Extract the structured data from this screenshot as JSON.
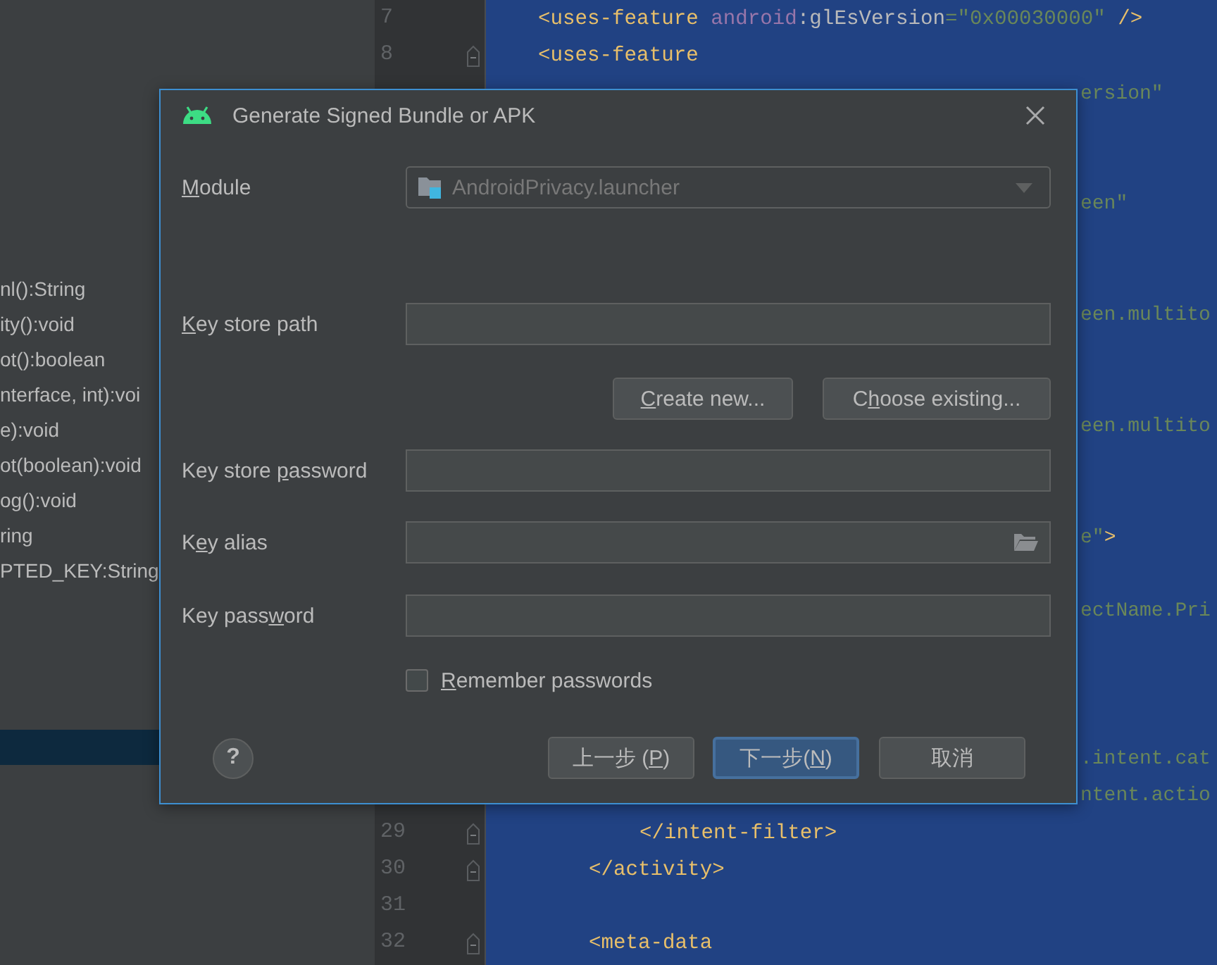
{
  "structure": {
    "items": [
      {
        "label": "nl():String",
        "selected": false
      },
      {
        "label": "ity():void",
        "selected": false
      },
      {
        "label": "ot():boolean",
        "selected": false
      },
      {
        "label": "nterface, int):voi",
        "selected": false
      },
      {
        "label": "e):void",
        "selected": false
      },
      {
        "label": "ot(boolean):void",
        "selected": false
      },
      {
        "label": "og():void",
        "selected": false
      },
      {
        "label": "ring",
        "selected": false
      },
      {
        "label": "PTED_KEY:String",
        "selected": false
      },
      {
        "selected": true
      }
    ]
  },
  "editor": {
    "lines": [
      {
        "kind": "code",
        "number": "7",
        "tokens": [
          {
            "text": "<uses-feature",
            "kind": "tag"
          },
          {
            "text": " android",
            "kind": "ns"
          },
          {
            "text": ":glEsVersion",
            "kind": "attr"
          },
          {
            "text": "=\"0x00030000\"",
            "kind": "value"
          },
          {
            "text": " />",
            "kind": "tag"
          }
        ]
      },
      {
        "kind": "code",
        "number": "8",
        "fold": true,
        "tokens": [
          {
            "text": "<uses-feature",
            "kind": "tag"
          }
        ]
      },
      {
        "kind": "fragment",
        "tokens": [
          {
            "text": "ersion\"",
            "kind": "value"
          }
        ]
      },
      {
        "kind": "covered"
      },
      {
        "kind": "covered"
      },
      {
        "kind": "fragment",
        "tokens": [
          {
            "text": "een\"",
            "kind": "value"
          }
        ]
      },
      {
        "kind": "covered"
      },
      {
        "kind": "covered"
      },
      {
        "kind": "fragment",
        "tokens": [
          {
            "text": "een.multito",
            "kind": "value"
          }
        ]
      },
      {
        "kind": "covered"
      },
      {
        "kind": "covered"
      },
      {
        "kind": "fragment",
        "tokens": [
          {
            "text": "een.multito",
            "kind": "value"
          }
        ]
      },
      {
        "kind": "covered"
      },
      {
        "kind": "covered"
      },
      {
        "kind": "fragment",
        "tokens": [
          {
            "text": "e\"",
            "kind": "value"
          },
          {
            "text": ">",
            "kind": "tag"
          }
        ]
      },
      {
        "kind": "covered"
      },
      {
        "kind": "fragment",
        "tokens": [
          {
            "text": "ectName.Pri",
            "kind": "value"
          }
        ]
      },
      {
        "kind": "covered"
      },
      {
        "kind": "covered"
      },
      {
        "kind": "covered"
      },
      {
        "kind": "fragment",
        "tokens": [
          {
            "text": ".intent.cat",
            "kind": "value"
          }
        ]
      },
      {
        "kind": "fragment",
        "tokens": [
          {
            "text": "ntent.actio",
            "kind": "value"
          }
        ]
      },
      {
        "kind": "code",
        "number": "29",
        "fold": true,
        "tokens": [
          {
            "text": "</intent-filter>",
            "kind": "tag"
          }
        ]
      },
      {
        "kind": "code",
        "number": "30",
        "fold": true,
        "tokens": [
          {
            "text": "</activity>",
            "kind": "tag"
          }
        ]
      },
      {
        "kind": "code",
        "number": "31",
        "fold": false
      },
      {
        "kind": "code",
        "number": "32",
        "fold": true,
        "tokens": [
          {
            "text": "<meta-data",
            "kind": "tag"
          }
        ]
      }
    ]
  },
  "dialog": {
    "title": "Generate Signed Bundle or APK",
    "rows": [
      {
        "kind": "combo",
        "label": {
          "key": "M",
          "post": "odule"
        },
        "value": "AndroidPrivacy.launcher",
        "disabled": true
      },
      {
        "kind": "field",
        "label": {
          "key": "K",
          "post": "ey store path"
        }
      },
      {
        "kind": "actions",
        "buttons": [
          {
            "key": "C",
            "post": "reate new..."
          },
          {
            "pre": "C",
            "key": "h",
            "post": "oose existing..."
          }
        ]
      },
      {
        "kind": "field",
        "label": {
          "pre": "Key store ",
          "key": "p",
          "post": "assword"
        }
      },
      {
        "kind": "browse",
        "label": {
          "pre": "K",
          "key": "e",
          "post": "y alias"
        }
      },
      {
        "kind": "field",
        "label": {
          "pre": "Key pass",
          "key": "w",
          "post": "ord"
        }
      },
      {
        "kind": "checkbox",
        "label": {
          "key": "R",
          "post": "emember passwords"
        },
        "checked": false
      }
    ],
    "help": "?",
    "buttons": [
      {
        "pre": "上一步 (",
        "key": "P",
        "post": ")",
        "selected": false
      },
      {
        "pre": "下一步(",
        "key": "N",
        "post": ")",
        "selected": true
      },
      {
        "pre": "取消",
        "selected": false
      }
    ]
  }
}
